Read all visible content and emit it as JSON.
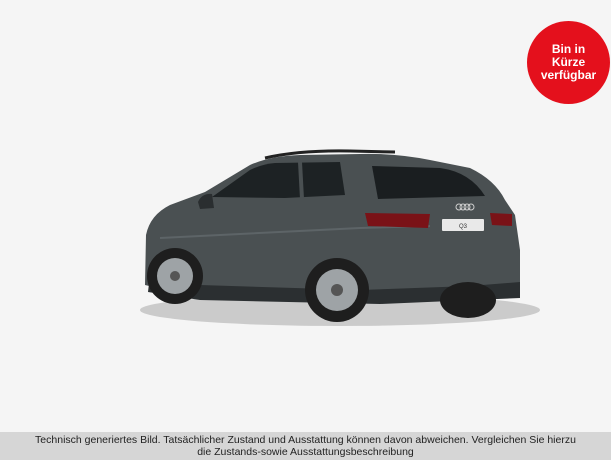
{
  "badge": {
    "text": "Bin in\nKürze\nverfügbar",
    "color": "#e4101c"
  },
  "vehicle_image": {
    "plate_text": "Q3",
    "body_color": "#4a5052"
  },
  "disclaimer": {
    "text": "Technisch generiertes Bild. Tatsächlicher Zustand und Ausstattung können davon abweichen. Vergleichen Sie hierzu\ndie Zustands-sowie Ausstattungsbeschreibung"
  }
}
